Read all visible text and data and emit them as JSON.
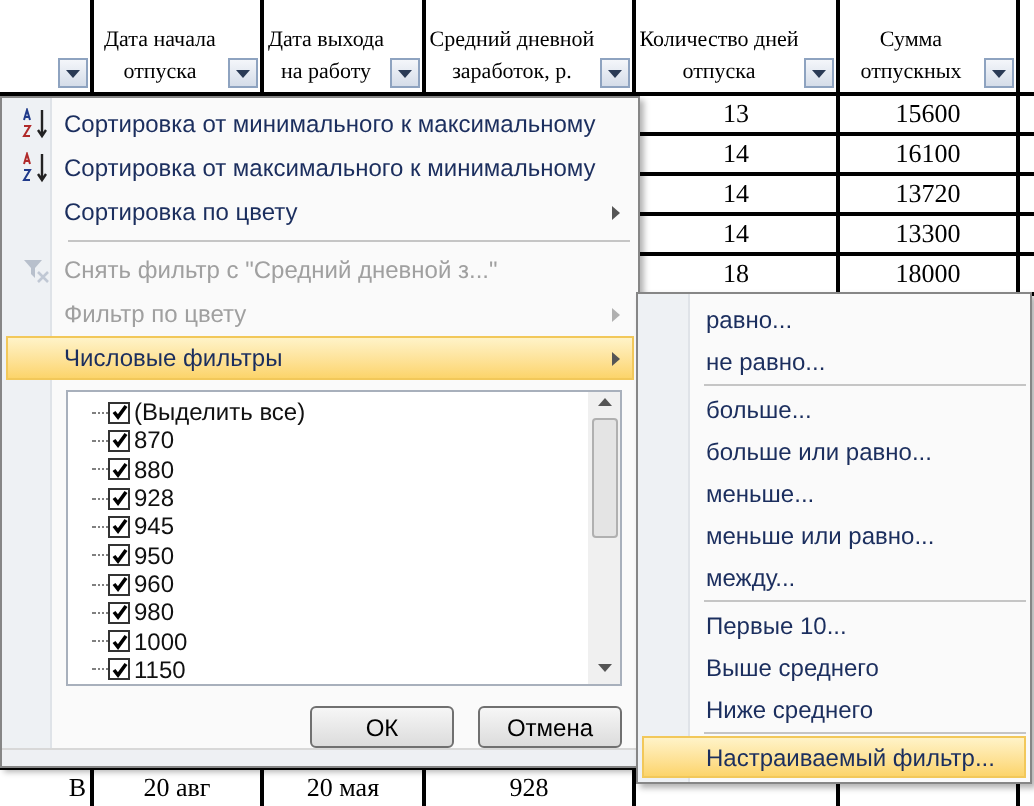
{
  "table": {
    "columns": [
      {
        "label": "Дата начала отпуска"
      },
      {
        "label": "Дата выхода на работу"
      },
      {
        "label": "Средний дневной заработок, р."
      },
      {
        "label": "Количество дней отпуска"
      },
      {
        "label": "Сумма отпускных"
      }
    ],
    "rows": [
      [
        "13",
        "15600"
      ],
      [
        "14",
        "16100"
      ],
      [
        "14",
        "13720"
      ],
      [
        "14",
        "13300"
      ],
      [
        "18",
        "18000"
      ]
    ],
    "bottom_row": [
      "В",
      "20 авг",
      "20 мая",
      "928"
    ]
  },
  "menu": {
    "items": [
      {
        "kind": "sort-asc",
        "label": "Сортировка от минимального к максимальному",
        "disabled": false,
        "submenu": false,
        "selected": false
      },
      {
        "kind": "sort-desc",
        "label": "Сортировка от максимального к минимальному",
        "disabled": false,
        "submenu": false,
        "selected": false
      },
      {
        "kind": "plain",
        "label": "Сортировка по цвету",
        "disabled": false,
        "submenu": true,
        "selected": false
      },
      {
        "kind": "separator"
      },
      {
        "kind": "clear-filter",
        "label": "Снять фильтр с \"Средний дневной з...\"",
        "disabled": true,
        "submenu": false,
        "selected": false
      },
      {
        "kind": "plain",
        "label": "Фильтр по цвету",
        "disabled": true,
        "submenu": true,
        "selected": false
      },
      {
        "kind": "plain",
        "label": "Числовые фильтры",
        "disabled": false,
        "submenu": true,
        "selected": true
      }
    ],
    "values": [
      {
        "label": "(Выделить все)",
        "checked": true
      },
      {
        "label": "870",
        "checked": true
      },
      {
        "label": "880",
        "checked": true
      },
      {
        "label": "928",
        "checked": true
      },
      {
        "label": "945",
        "checked": true
      },
      {
        "label": "950",
        "checked": true
      },
      {
        "label": "960",
        "checked": true
      },
      {
        "label": "980",
        "checked": true
      },
      {
        "label": "1000",
        "checked": true
      },
      {
        "label": "1150",
        "checked": true
      }
    ],
    "buttons": [
      "ОК",
      "Отмена"
    ]
  },
  "submenu": {
    "items": [
      {
        "kind": "item",
        "label": "равно...",
        "selected": false
      },
      {
        "kind": "item",
        "label": "не равно...",
        "selected": false
      },
      {
        "kind": "separator"
      },
      {
        "kind": "item",
        "label": "больше...",
        "selected": false
      },
      {
        "kind": "item",
        "label": "больше или равно...",
        "selected": false
      },
      {
        "kind": "item",
        "label": "меньше...",
        "selected": false
      },
      {
        "kind": "item",
        "label": "меньше или равно...",
        "selected": false
      },
      {
        "kind": "item",
        "label": "между...",
        "selected": false
      },
      {
        "kind": "separator"
      },
      {
        "kind": "item",
        "label": "Первые 10...",
        "selected": false
      },
      {
        "kind": "item",
        "label": "Выше среднего",
        "selected": false
      },
      {
        "kind": "item",
        "label": "Ниже среднего",
        "selected": false
      },
      {
        "kind": "separator"
      },
      {
        "kind": "item",
        "label": "Настраиваемый фильтр...",
        "selected": true
      }
    ]
  }
}
